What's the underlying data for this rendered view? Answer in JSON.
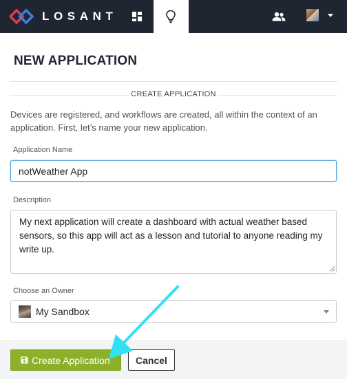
{
  "nav": {
    "brand": "LOSANT",
    "icons": {
      "logo": "losant-logo-icon",
      "dashboards": "dashboard-grid-icon",
      "ideas": "lightbulb-icon",
      "team": "people-icon",
      "user_menu": "chevron-down-icon"
    }
  },
  "page": {
    "title": "NEW APPLICATION",
    "section_label": "CREATE APPLICATION",
    "intro": "Devices are registered, and workflows are created, all within the context of an application. First, let’s name your new application."
  },
  "form": {
    "name_label": "Application Name",
    "name_value": "notWeather App",
    "description_label": "Description",
    "description_value": "My next application will create a dashboard with actual weather based sensors, so this app will act as a lesson and tutorial to anyone reading my write up.",
    "owner_label": "Choose an Owner",
    "owner_value": "My Sandbox"
  },
  "actions": {
    "create_label": "Create Application",
    "create_icon": "save-icon",
    "cancel_label": "Cancel"
  },
  "colors": {
    "nav_bg": "#1f2531",
    "logo_red": "#e13a4c",
    "logo_blue": "#3d7de0",
    "create_button": "#8bb12a",
    "annotation_arrow": "#31e0f2",
    "input_focus": "#56a6e0"
  }
}
